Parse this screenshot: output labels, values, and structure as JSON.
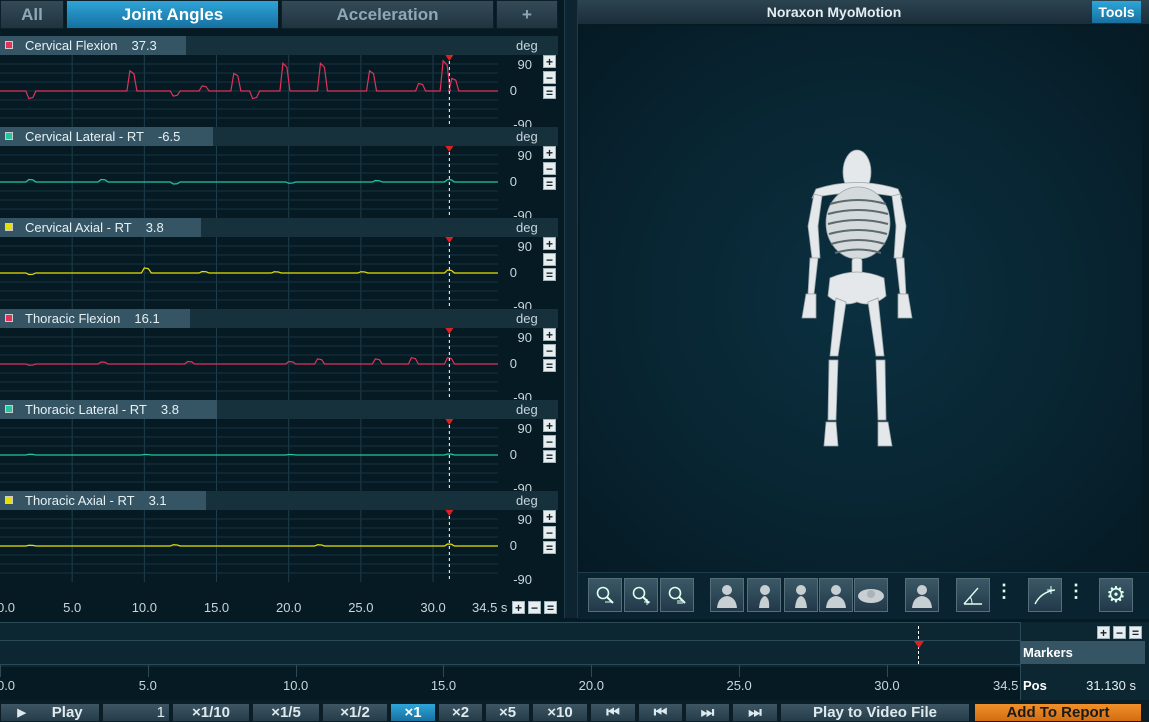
{
  "tabs": {
    "all": "All",
    "joint_angles": "Joint Angles",
    "acceleration": "Acceleration",
    "add": "+"
  },
  "channels": [
    {
      "name": "Cervical Flexion",
      "value": "37.3",
      "color": "#e0325a"
    },
    {
      "name": "Cervical Lateral - RT",
      "value": "-6.5",
      "color": "#20c8a0"
    },
    {
      "name": "Cervical Axial - RT",
      "value": "3.8",
      "color": "#e8e000"
    },
    {
      "name": "Thoracic Flexion",
      "value": "16.1",
      "color": "#e0325a"
    },
    {
      "name": "Thoracic Lateral - RT",
      "value": "3.8",
      "color": "#20c8a0"
    },
    {
      "name": "Thoracic Axial - RT",
      "value": "3.1",
      "color": "#e8e000"
    }
  ],
  "axis": {
    "unit": "deg",
    "max": "90",
    "zero": "0",
    "min": "-90"
  },
  "x_ticks": [
    "0.0",
    "5.0",
    "10.0",
    "15.0",
    "20.0",
    "25.0",
    "30.0"
  ],
  "x_end": "34.5 s",
  "timeline_ticks": [
    "0.0",
    "5.0",
    "10.0",
    "15.0",
    "20.0",
    "25.0",
    "30.0"
  ],
  "timeline_end": "34.5",
  "viewer": {
    "title": "Noraxon MyoMotion",
    "tools": "Tools"
  },
  "markers": {
    "label": "Markers",
    "pos_label": "Pos",
    "pos_value": "31.130 s"
  },
  "bottom_bar": {
    "play": "Play",
    "frame": "1",
    "speeds": [
      "×1/10",
      "×1/5",
      "×1/2",
      "×1",
      "×2",
      "×5",
      "×10"
    ],
    "play_video": "Play to Video File",
    "add_report": "Add To Report"
  },
  "icons": [
    "zoom-out-icon",
    "zoom-in-icon",
    "zoom-reset-icon",
    "front-view-icon",
    "side-view-icon",
    "back-view-icon",
    "back-view-2-icon",
    "top-view-icon",
    "skeleton-view-icon",
    "angle-icon",
    "curve-icon",
    "gear-icon"
  ],
  "cursor_time": 31.13
}
